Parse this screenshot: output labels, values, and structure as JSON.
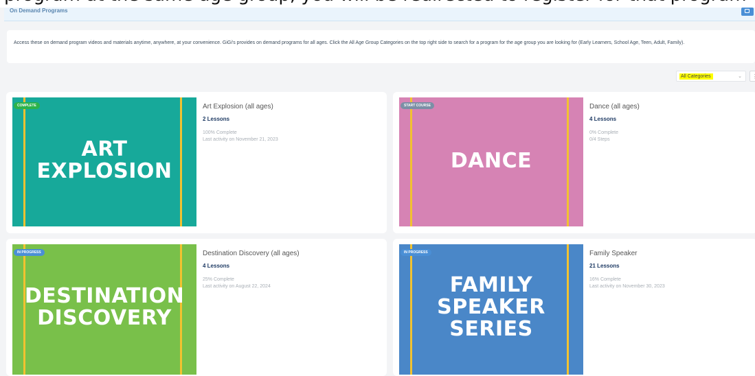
{
  "overflow_banner": "program at the same age group, you will be redirected to register for that program",
  "header": {
    "title": "On Demand Programs",
    "button_icon": "square-icon"
  },
  "intro": {
    "text": "Access these on demand program videos and materials anytime, anywhere, at your convenience. GiGi's provides on demand programs for all ages. Click the All Age Group Categories on the top right side to search for a program for the age group you are looking for (Early Learners, School Age, Teen, Adult, Family)."
  },
  "filter": {
    "selected": "All Categories",
    "chevron_icon": "chevron-down-icon",
    "view_icon": "menu-icon"
  },
  "courses": [
    {
      "thumb_title": "ART\nEXPLOSION",
      "thumb_color": "#17a99a",
      "badge": "COMPLETE",
      "badge_color": "#2cb34a",
      "name": "Art Explosion (all ages)",
      "lessons": "2 Lessons",
      "progress": "100% Complete",
      "activity": "Last activity on November 21, 2023"
    },
    {
      "thumb_title": "DANCE",
      "thumb_color": "#d683b4",
      "badge": "START COURSE",
      "badge_color": "#7b8fa6",
      "name": "Dance (all ages)",
      "lessons": "4 Lessons",
      "progress": "0% Complete",
      "activity": "0/4 Steps"
    },
    {
      "thumb_title": "DESTINATION\nDISCOVERY",
      "thumb_color": "#79c04a",
      "badge": "IN PROGRESS",
      "badge_color": "#4a8fd6",
      "name": "Destination Discovery (all ages)",
      "lessons": "4 Lessons",
      "progress": "25% Complete",
      "activity": "Last activity on August 22, 2024"
    },
    {
      "thumb_title": "FAMILY\nSPEAKER\nSERIES",
      "thumb_color": "#4a87c8",
      "badge": "IN PROGRESS",
      "badge_color": "#4a8fd6",
      "name": "Family Speaker",
      "lessons": "21 Lessons",
      "progress": "16% Complete",
      "activity": "Last activity on November 30, 2023"
    }
  ]
}
